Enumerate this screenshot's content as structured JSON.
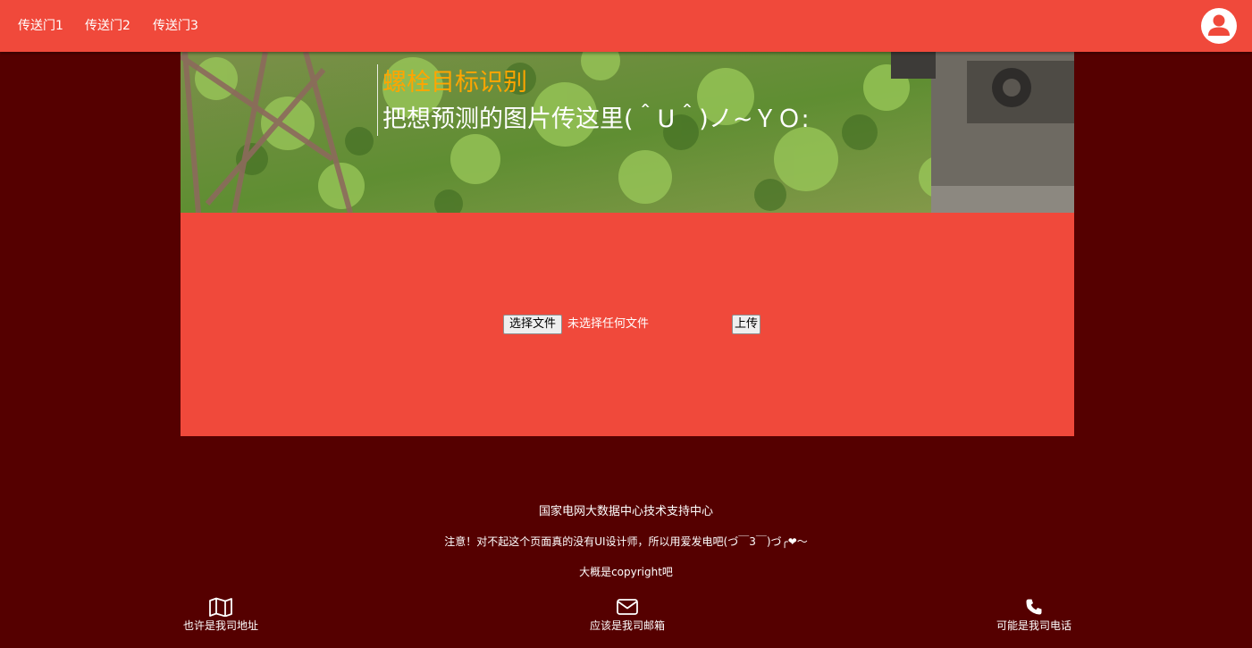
{
  "nav": {
    "links": [
      "传送门1",
      "传送门2",
      "传送门3"
    ],
    "avatar_icon": "user-icon"
  },
  "banner": {
    "title": "螺栓目标识别",
    "subtitle": "把想预测的图片传这里(＾U＾)ノ~ＹＯ:"
  },
  "upload": {
    "choose_button": "选择文件",
    "file_status": "未选择任何文件",
    "submit_button": "上传"
  },
  "footer": {
    "org": "国家电网大数据中心技术支持中心",
    "notice": "注意！对不起这个页面真的没有UI设计师，所以用爱发电吧(づ￣3￣)づ╭❤～",
    "copyright": "大概是copyright吧"
  },
  "contacts": [
    {
      "icon": "map-icon",
      "label": "也许是我司地址"
    },
    {
      "icon": "envelope-icon",
      "label": "应该是我司邮箱"
    },
    {
      "icon": "phone-icon",
      "label": "可能是我司电话"
    }
  ],
  "colors": {
    "header": "#f0493b",
    "background": "#550000",
    "title_accent": "#ffa500"
  }
}
